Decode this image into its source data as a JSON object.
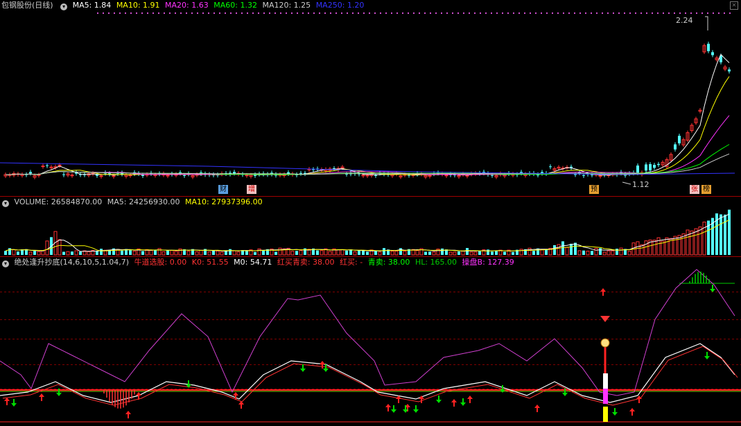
{
  "price_panel": {
    "title": "包钢股份(日线)",
    "ma": [
      {
        "label": "MA5: 1.84",
        "color": "#ffffff"
      },
      {
        "label": "MA10: 1.91",
        "color": "#ffff00"
      },
      {
        "label": "MA20: 1.63",
        "color": "#ff33ff"
      },
      {
        "label": "MA60: 1.32",
        "color": "#00ff00"
      },
      {
        "label": "MA120: 1.25",
        "color": "#cccccc"
      },
      {
        "label": "MA250: 1.20",
        "color": "#3333ff"
      }
    ],
    "high_label": "2.24",
    "low_label": "1.12",
    "tags": [
      "财",
      "增",
      "预",
      "张",
      "榜"
    ]
  },
  "volume_panel": {
    "items": [
      {
        "label": "VOLUME: 26584870.00",
        "color": "#cccccc"
      },
      {
        "label": "MA5: 24256930.00",
        "color": "#cccccc"
      },
      {
        "label": "MA10: 27937396.00",
        "color": "#ffff00"
      }
    ]
  },
  "indicator_panel": {
    "title": "绝处逢升抄底(14,6,10,5,1.04,7)",
    "items": [
      {
        "label": "牛道选股: 0.00",
        "color": "#ff3333"
      },
      {
        "label": "K0: 51.55",
        "color": "#ff3333"
      },
      {
        "label": "M0: 54.71",
        "color": "#ffffff"
      },
      {
        "label": "红买青卖: 38.00",
        "color": "#ff3333"
      },
      {
        "label": "红买: -",
        "color": "#ff3333"
      },
      {
        "label": "青卖: 38.00",
        "color": "#00ff00"
      },
      {
        "label": "HL: 165.00",
        "color": "#00cc00"
      },
      {
        "label": "操盘B: 127.39",
        "color": "#ff33ff"
      }
    ]
  },
  "colors": {
    "up": "#ff3333",
    "down": "#54ffff",
    "grid": "#a00000"
  }
}
